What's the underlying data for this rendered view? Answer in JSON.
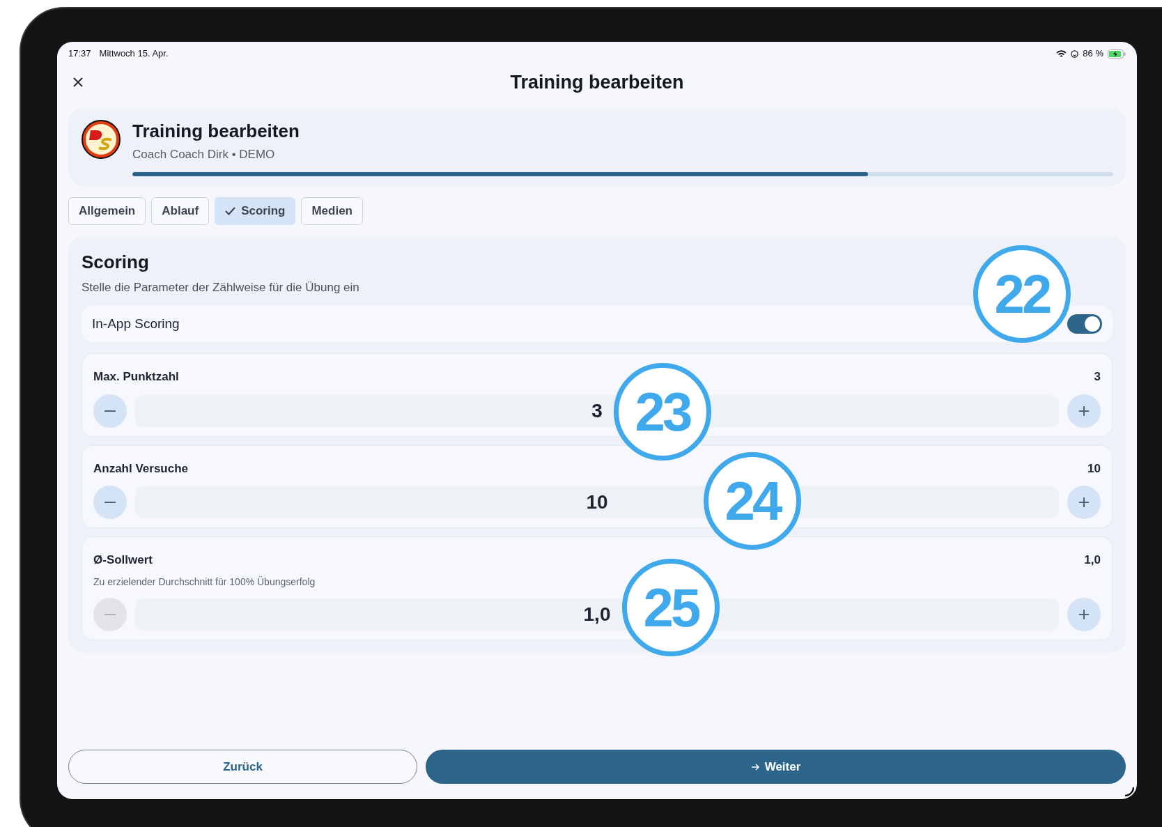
{
  "status_bar": {
    "time": "17:37",
    "date": "Mittwoch 15. Apr.",
    "battery": "86 %"
  },
  "header": {
    "title": "Training bearbeiten"
  },
  "summary": {
    "title": "Training bearbeiten",
    "subtitle": "Coach Coach Dirk • DEMO",
    "progress": {
      "level": 0.75
    }
  },
  "tabs": [
    {
      "label": "Allgemein",
      "selected": false
    },
    {
      "label": "Ablauf",
      "selected": false
    },
    {
      "label": "Scoring",
      "selected": true
    },
    {
      "label": "Medien",
      "selected": false
    }
  ],
  "section": {
    "title": "Scoring",
    "description": "Stelle die Parameter der Zählweise für die Übung ein",
    "toggle": {
      "label": "In-App Scoring",
      "on": true
    },
    "steppers": [
      {
        "label": "Max. Punktzahl",
        "reading": "3",
        "value": "3",
        "decrement_disabled": false
      },
      {
        "label": "Anzahl Versuche",
        "reading": "10",
        "value": "10",
        "decrement_disabled": false
      },
      {
        "label": "Ø-Sollwert",
        "hint": "Zu erzielender Durchschnitt für 100% Übungserfolg",
        "reading": "1,0",
        "value": "1,0",
        "decrement_disabled": true
      }
    ]
  },
  "footer": {
    "back": "Zurück",
    "next": "Weiter"
  },
  "callouts": [
    "22",
    "23",
    "24",
    "25"
  ]
}
